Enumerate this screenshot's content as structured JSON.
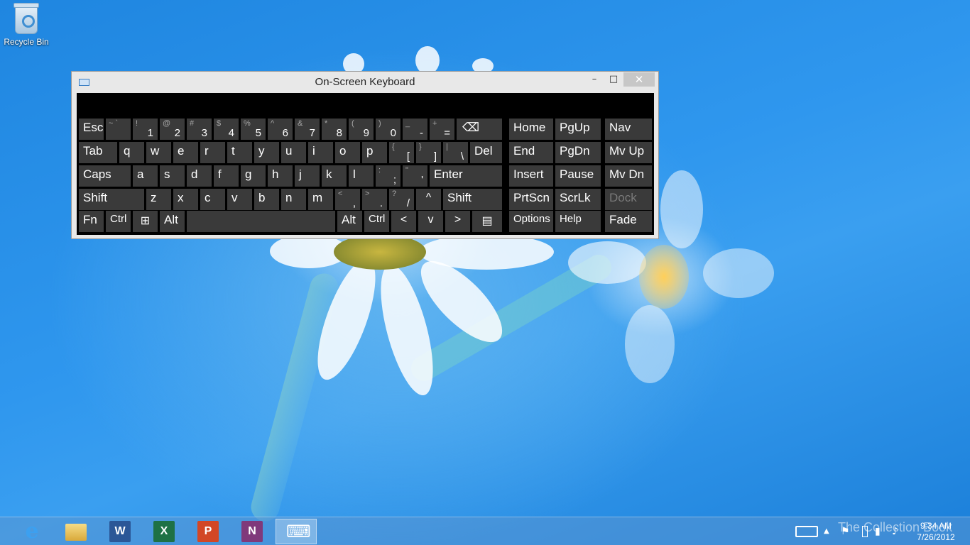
{
  "desktop": {
    "recycle_bin_label": "Recycle Bin"
  },
  "osk": {
    "title": "On-Screen Keyboard",
    "minimize_glyph": "–",
    "maximize_glyph": "□",
    "close_glyph": "✕",
    "keys": {
      "esc": "Esc",
      "tilde": {
        "top": "~ `",
        "bot": ""
      },
      "n1": {
        "top": "!",
        "bot": "1"
      },
      "n2": {
        "top": "@",
        "bot": "2"
      },
      "n3": {
        "top": "#",
        "bot": "3"
      },
      "n4": {
        "top": "$",
        "bot": "4"
      },
      "n5": {
        "top": "%",
        "bot": "5"
      },
      "n6": {
        "top": "^",
        "bot": "6"
      },
      "n7": {
        "top": "&",
        "bot": "7"
      },
      "n8": {
        "top": "*",
        "bot": "8"
      },
      "n9": {
        "top": "(",
        "bot": "9"
      },
      "n0": {
        "top": ")",
        "bot": "0"
      },
      "minus": {
        "top": "_",
        "bot": "-"
      },
      "equals": {
        "top": "+",
        "bot": "="
      },
      "backspace": "⌫",
      "tab": "Tab",
      "q": "q",
      "w": "w",
      "e": "e",
      "r": "r",
      "t": "t",
      "y": "y",
      "u": "u",
      "i": "i",
      "o": "o",
      "p": "p",
      "lbracket": {
        "top": "{",
        "bot": "["
      },
      "rbracket": {
        "top": "}",
        "bot": "]"
      },
      "backslash": {
        "top": "|",
        "bot": "\\"
      },
      "del": "Del",
      "caps": "Caps",
      "a": "a",
      "s": "s",
      "d": "d",
      "f": "f",
      "g": "g",
      "h": "h",
      "j": "j",
      "k": "k",
      "l": "l",
      "semicolon": {
        "top": ":",
        "bot": ";"
      },
      "quote": {
        "top": "\"",
        "bot": "'"
      },
      "enter": "Enter",
      "shift_left": "Shift",
      "z": "z",
      "x": "x",
      "c": "c",
      "v": "v",
      "b": "b",
      "n": "n",
      "m": "m",
      "comma": {
        "top": "<",
        "bot": ","
      },
      "period": {
        "top": ">",
        "bot": "."
      },
      "slash": {
        "top": "?",
        "bot": "/"
      },
      "up": "^",
      "shift_right": "Shift",
      "fn": "Fn",
      "ctrl_left": "Ctrl",
      "win": "⊞",
      "alt_left": "Alt",
      "space": "",
      "alt_right": "Alt",
      "ctrl_right": "Ctrl",
      "left": "<",
      "down": "v",
      "right": ">",
      "menu": "▤",
      "home": "Home",
      "pgup": "PgUp",
      "nav": "Nav",
      "end": "End",
      "pgdn": "PgDn",
      "mvup": "Mv Up",
      "insert": "Insert",
      "pause": "Pause",
      "mvdn": "Mv Dn",
      "prtscn": "PrtScn",
      "scrlk": "ScrLk",
      "dock": "Dock",
      "options": "Options",
      "help": "Help",
      "fade": "Fade"
    }
  },
  "taskbar": {
    "apps": [
      {
        "name": "Internet Explorer",
        "icon": "ie-icon",
        "glyph": "e",
        "color": "#1f8fe0"
      },
      {
        "name": "File Explorer",
        "icon": "folder-icon",
        "glyph": "",
        "color": "#e9c25a"
      },
      {
        "name": "Word",
        "icon": "word-icon",
        "glyph": "W",
        "color": "#2b5797"
      },
      {
        "name": "Excel",
        "icon": "excel-icon",
        "glyph": "X",
        "color": "#1e7145"
      },
      {
        "name": "PowerPoint",
        "icon": "powerpoint-icon",
        "glyph": "P",
        "color": "#d24726"
      },
      {
        "name": "OneNote",
        "icon": "onenote-icon",
        "glyph": "N",
        "color": "#80397b"
      },
      {
        "name": "On-Screen Keyboard",
        "icon": "keyboard-icon",
        "glyph": "⌨",
        "color": "#5b8fc8"
      }
    ],
    "clock_time": "9:34 AM",
    "clock_date": "7/26/2012",
    "watermark": "The Collection Book"
  }
}
